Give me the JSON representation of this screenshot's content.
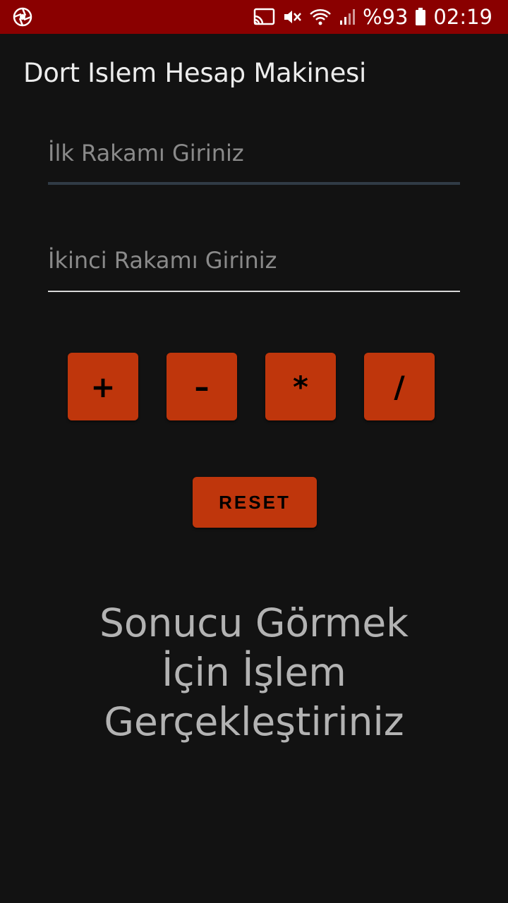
{
  "status_bar": {
    "left_icon": "camera-aperture-icon",
    "icons": [
      "cast-icon",
      "mute-icon",
      "wifi-icon",
      "signal-icon",
      "battery-icon"
    ],
    "battery_text": "%93",
    "time": "02:19",
    "background": "#8a0000"
  },
  "app": {
    "title": "Dort Islem Hesap Makinesi"
  },
  "inputs": {
    "first": {
      "value": "",
      "placeholder": "İlk Rakamı Giriniz"
    },
    "second": {
      "value": "",
      "placeholder": "İkinci Rakamı Giriniz"
    }
  },
  "operations": {
    "add": "+",
    "subtract": "–",
    "multiply": "*",
    "divide": "/"
  },
  "reset_label": "RESET",
  "result_text": "Sonucu Görmek\nİçin İşlem\nGerçekleştiriniz",
  "colors": {
    "background": "#121212",
    "accent": "#bf360c",
    "result_text": "#b3b3b3"
  }
}
